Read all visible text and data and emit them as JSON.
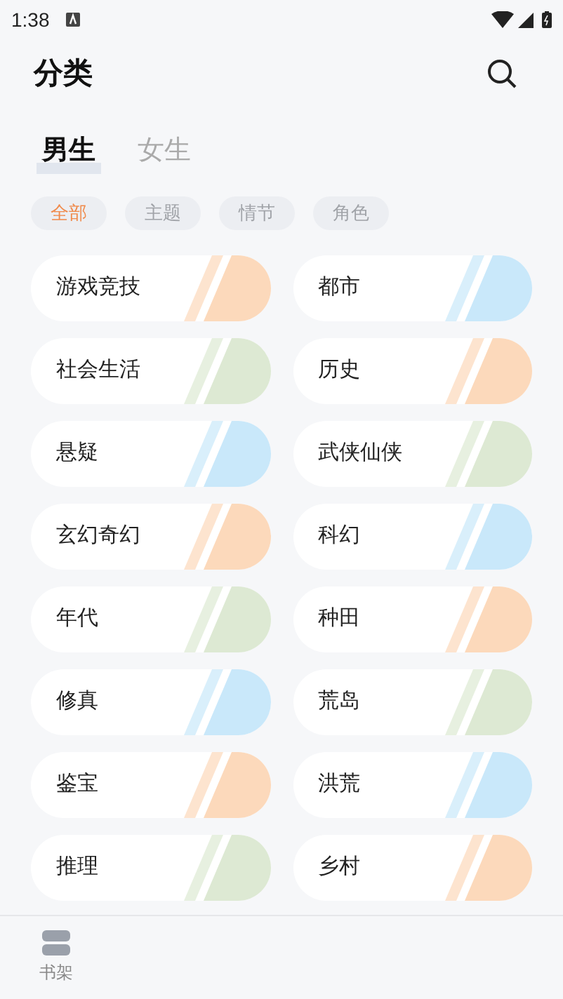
{
  "status_bar": {
    "time": "1:38"
  },
  "header": {
    "title": "分类"
  },
  "tabs": [
    {
      "label": "男生",
      "selected": true
    },
    {
      "label": "女生",
      "selected": false
    }
  ],
  "filters": [
    {
      "label": "全部",
      "selected": true
    },
    {
      "label": "主题",
      "selected": false
    },
    {
      "label": "情节",
      "selected": false
    },
    {
      "label": "角色",
      "selected": false
    }
  ],
  "categories": [
    {
      "label": "游戏竞技",
      "color": "#fcd9bb"
    },
    {
      "label": "都市",
      "color": "#c9e8fa"
    },
    {
      "label": "社会生活",
      "color": "#dde9d3"
    },
    {
      "label": "历史",
      "color": "#fcd9bb"
    },
    {
      "label": "悬疑",
      "color": "#c9e8fa"
    },
    {
      "label": "武侠仙侠",
      "color": "#dde9d3"
    },
    {
      "label": "玄幻奇幻",
      "color": "#fcd9bb"
    },
    {
      "label": "科幻",
      "color": "#c9e8fa"
    },
    {
      "label": "年代",
      "color": "#dde9d3"
    },
    {
      "label": "种田",
      "color": "#fcd9bb"
    },
    {
      "label": "修真",
      "color": "#c9e8fa"
    },
    {
      "label": "荒岛",
      "color": "#dde9d3"
    },
    {
      "label": "鉴宝",
      "color": "#fcd9bb"
    },
    {
      "label": "洪荒",
      "color": "#c9e8fa"
    },
    {
      "label": "推理",
      "color": "#dde9d3"
    },
    {
      "label": "乡村",
      "color": "#fcd9bb"
    }
  ],
  "bottom_nav": [
    {
      "label": "书架",
      "selected": false
    }
  ]
}
